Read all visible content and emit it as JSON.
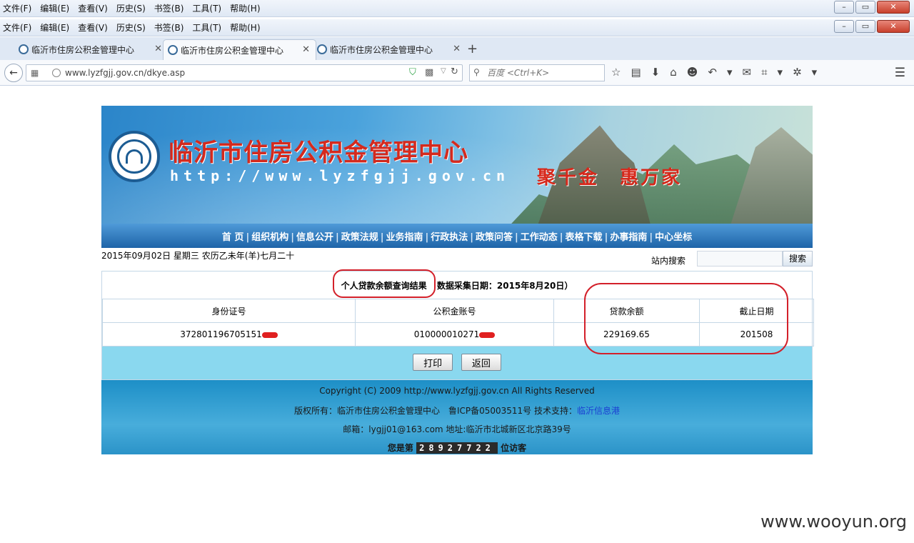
{
  "browser": {
    "menu": [
      "文件(F)",
      "编辑(E)",
      "查看(V)",
      "历史(S)",
      "书签(B)",
      "工具(T)",
      "帮助(H)"
    ],
    "tabs": [
      "临沂市住房公积金管理中心",
      "临沂市住房公积金管理中心",
      "临沂市住房公积金管理中心"
    ],
    "active_tab_index": 1,
    "url": "www.lyzfgjj.gov.cn/dkye.asp",
    "search_placeholder": "百度 <Ctrl+K>"
  },
  "site": {
    "name": "临沂市住房公积金管理中心",
    "url": "http://www.lyzfgjj.gov.cn",
    "slogan": "聚千金　惠万家",
    "nav": [
      "首 页",
      "组织机构",
      "信息公开",
      "政策法规",
      "业务指南",
      "行政执法",
      "政策问答",
      "工作动态",
      "表格下载",
      "办事指南",
      "中心坐标"
    ],
    "date_line": "2015年09月02日 星期三 农历乙未年(羊)七月二十",
    "site_search_label": "站内搜索",
    "search_button": "搜索"
  },
  "result": {
    "title": "个人贷款余额查询结果",
    "date_note": "数据采集日期：2015年8月20日）",
    "columns": [
      "身份证号",
      "公积金账号",
      "贷款余额",
      "截止日期"
    ],
    "row": {
      "id_number": "372801196705151",
      "account": "010000010271",
      "balance": "229169.65",
      "as_of": "201508"
    },
    "print_button": "打印",
    "back_button": "返回"
  },
  "footer": {
    "copyright": "Copyright (C) 2009 http://www.lyzfgjj.gov.cn All Rights Reserved",
    "owner_prefix": "版权所有：临沂市住房公积金管理中心　鲁ICP备05003511号 技术支持：",
    "tech_support": "临沂信息港",
    "contact": "邮箱：lygjj01@163.com 地址:临沂市北城新区北京路39号",
    "visitor_prefix": "您是第",
    "visitor_count": "28927722",
    "visitor_suffix": "位访客"
  },
  "watermark": "www.wooyun.org",
  "colors": {
    "highlight": "#d3202a",
    "nav_bg": "#1e64a8",
    "button_row_bg": "#8ad8ef",
    "footer_bg": "#1d8fc7"
  }
}
